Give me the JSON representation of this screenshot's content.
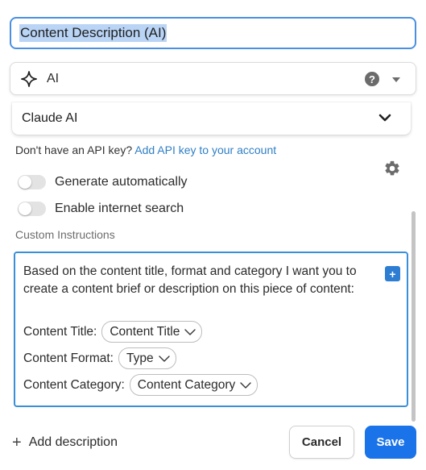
{
  "field": {
    "name_value": "Content Description (AI)"
  },
  "type_select": {
    "label": "AI",
    "help": "?"
  },
  "model_select": {
    "label": "Claude AI"
  },
  "api": {
    "prompt": "Don't have an API key?",
    "link": "Add API key to your account"
  },
  "toggles": [
    {
      "label": "Generate automatically",
      "on": false
    },
    {
      "label": "Enable internet search",
      "on": false
    }
  ],
  "custom_instructions": {
    "label": "Custom Instructions",
    "text": "Based on the content title, format and category I want you to create a content brief or description on this piece of content:",
    "insert_button": "+",
    "variables": [
      {
        "label": "Content Title:",
        "chip": "Content Title"
      },
      {
        "label": "Content Format:",
        "chip": "Type"
      },
      {
        "label": "Content Category:",
        "chip": "Content Category"
      }
    ]
  },
  "footer": {
    "add_description": "Add description",
    "cancel": "Cancel",
    "save": "Save"
  },
  "colors": {
    "accent": "#1a73e8",
    "link": "#2f7fc5",
    "focus_border": "#3a8fd9",
    "selection": "#b9d4f5"
  },
  "icons": {
    "ai": "sparkle-icon",
    "help": "help-icon",
    "dropdown": "caret-down-icon",
    "model_dropdown": "chevron-down-icon",
    "settings": "gear-icon",
    "insert": "plus-icon",
    "add": "plus-icon"
  }
}
